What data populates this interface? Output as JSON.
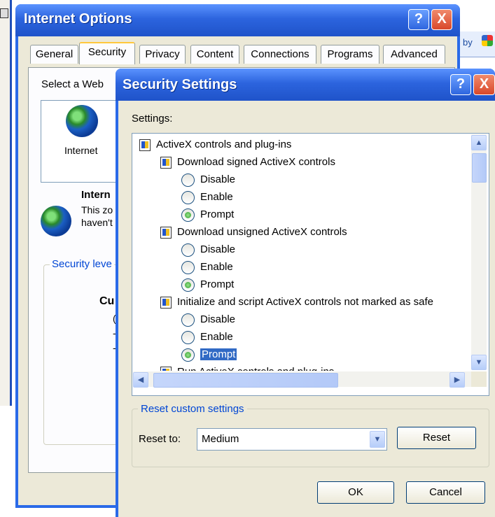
{
  "background": {
    "right_text": "by"
  },
  "internet_options": {
    "title": "Internet Options",
    "help": "?",
    "close": "X",
    "tabs": [
      "General",
      "Security",
      "Privacy",
      "Content",
      "Connections",
      "Programs",
      "Advanced"
    ],
    "select_zone_text": "Select a Web",
    "zone_label": "Internet",
    "zone_heading": "Intern",
    "zone_desc_1": "This zo",
    "zone_desc_2": "haven't",
    "security_level": "Security leve",
    "level_heading": "Cu",
    "level_mark_1": "(",
    "level_mark_2": "-",
    "level_mark_3": "-"
  },
  "security_settings": {
    "title": "Security Settings",
    "help": "?",
    "close": "X",
    "settings_label": "Settings:",
    "tree": [
      {
        "kind": "category",
        "label": "ActiveX controls and plug-ins"
      },
      {
        "kind": "item",
        "label": "Download signed ActiveX controls"
      },
      {
        "kind": "option",
        "label": "Disable",
        "checked": false
      },
      {
        "kind": "option",
        "label": "Enable",
        "checked": false
      },
      {
        "kind": "option",
        "label": "Prompt",
        "checked": true
      },
      {
        "kind": "item",
        "label": "Download unsigned ActiveX controls"
      },
      {
        "kind": "option",
        "label": "Disable",
        "checked": false
      },
      {
        "kind": "option",
        "label": "Enable",
        "checked": false
      },
      {
        "kind": "option",
        "label": "Prompt",
        "checked": true
      },
      {
        "kind": "item",
        "label": "Initialize and script ActiveX controls not marked as safe"
      },
      {
        "kind": "option",
        "label": "Disable",
        "checked": false
      },
      {
        "kind": "option",
        "label": "Enable",
        "checked": false
      },
      {
        "kind": "option",
        "label": "Prompt",
        "checked": true,
        "selected": true
      },
      {
        "kind": "item",
        "label": "Run ActiveX controls and plug-ins"
      }
    ],
    "reset_group_label": "Reset custom settings",
    "reset_to_label": "Reset to:",
    "reset_to_value": "Medium",
    "reset_button": "Reset",
    "ok_button": "OK",
    "cancel_button": "Cancel"
  }
}
